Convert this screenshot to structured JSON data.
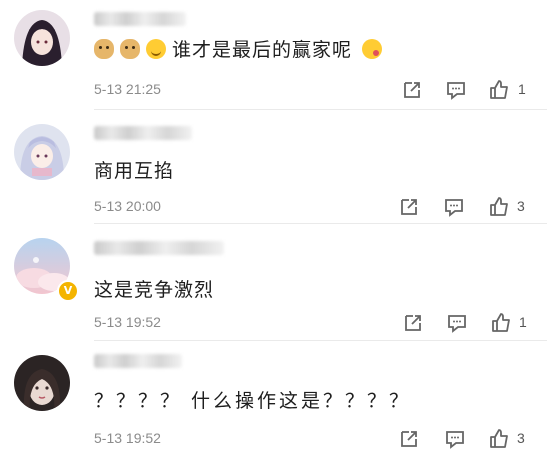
{
  "comments": [
    {
      "text": "谁才是最后的赢家呢",
      "time": "5-13 21:25",
      "likes": "1",
      "emoji": [
        "dog-emoji",
        "dog-emoji",
        "smile-emoji"
      ],
      "trailing_emoji": "yum-emoji"
    },
    {
      "text": "商用互掐",
      "time": "5-13 20:00",
      "likes": "3"
    },
    {
      "text": "这是竞争激烈",
      "time": "5-13 19:52",
      "likes": "1",
      "verified_badge": "V"
    },
    {
      "text": "？？？？ 什么操作这是？？？？",
      "time": "5-13 19:52",
      "likes": "3"
    }
  ],
  "icons": {
    "share": "share-icon",
    "reply": "comment-icon",
    "like": "thumbs-up-icon"
  },
  "colors": {
    "text": "#1e1e1e",
    "meta": "#8b8b8b",
    "badge": "#f4b400"
  }
}
